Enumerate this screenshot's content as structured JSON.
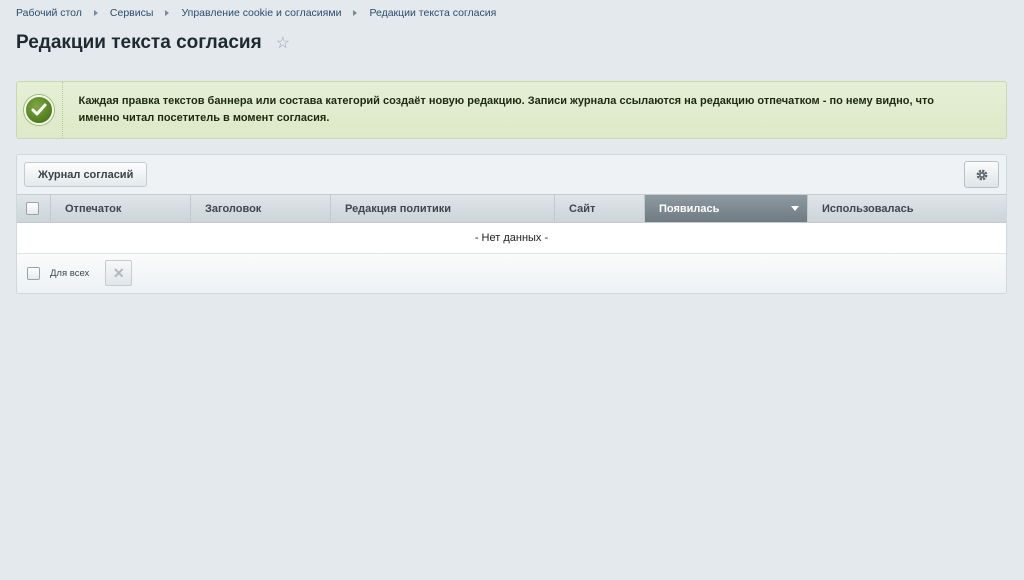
{
  "breadcrumbs": [
    "Рабочий стол",
    "Сервисы",
    "Управление cookie и согласиями",
    "Редакции текста согласия"
  ],
  "page": {
    "title": "Редакции текста согласия"
  },
  "notice": {
    "text": "Каждая правка текстов баннера или состава категорий создаёт новую редакцию. Записи журнала ссылаются на редакцию отпечатком - по нему видно, что именно читал посетитель в момент согласия."
  },
  "toolbar": {
    "journal_label": "Журнал согласий"
  },
  "table": {
    "columns": [
      "Отпечаток",
      "Заголовок",
      "Редакция политики",
      "Сайт",
      "Появилась",
      "Использовалась"
    ],
    "sorted_column": "Появилась",
    "empty_text": "- Нет данных -"
  },
  "footer": {
    "for_all_label": "Для всех"
  },
  "colors": {
    "page_bg": "#e3e9ec",
    "notice_bg": "#dde9c8",
    "active_header": "#7b878e"
  }
}
